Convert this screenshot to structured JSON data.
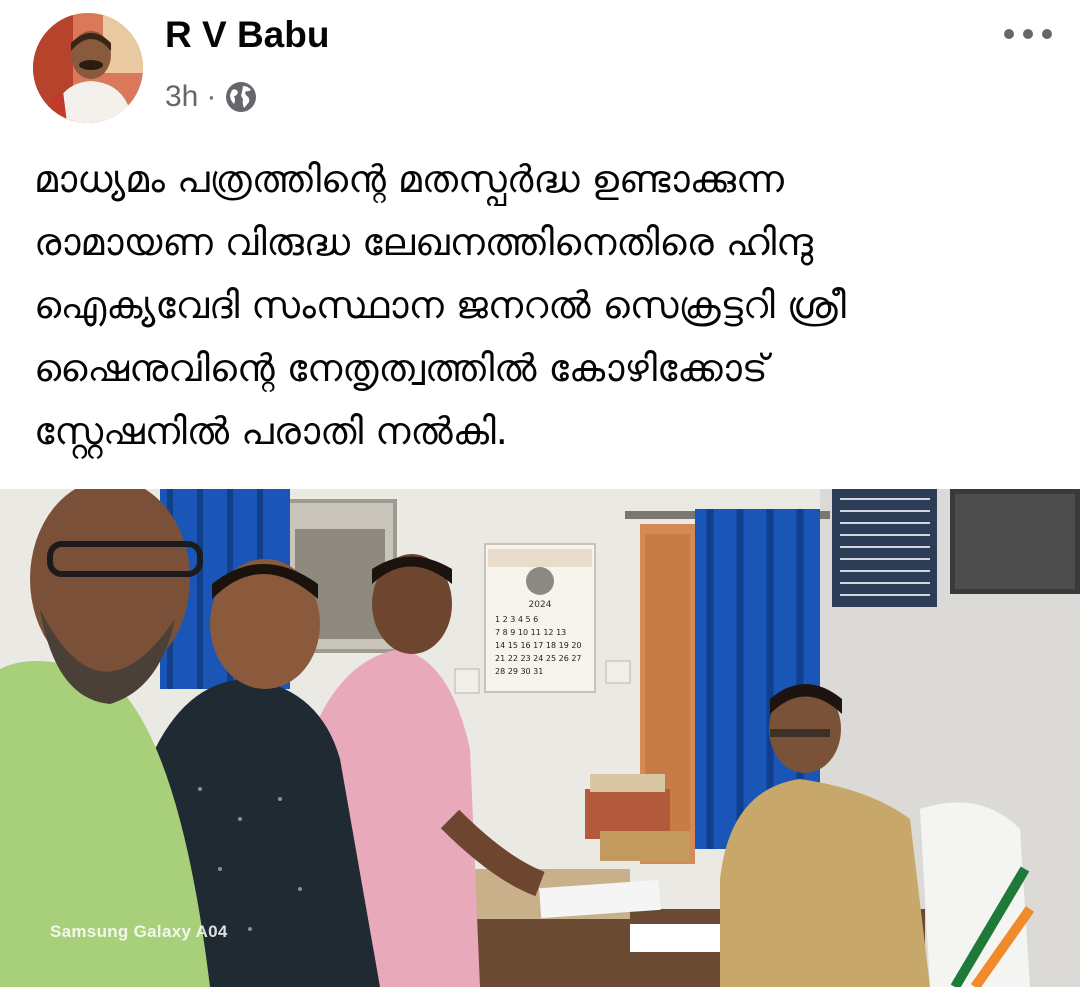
{
  "post": {
    "author": "R V Babu",
    "time": "3h",
    "separator": "·",
    "privacy_icon": "globe-icon",
    "menu_icon": "more-options-icon",
    "text_lines": [
      "മാധ്യമം പത്രത്തിന്റെ മതസ്പർദ്ധ ഉണ്ടാക്കുന്ന",
      "രാമായണ വിരുദ്ധ ലേഖനത്തിനെതിരെ ഹിന്ദു",
      "ഐക്യവേദി സംസ്ഥാന ജനറൽ സെക്രട്ടറി ശ്രീ",
      "ഷൈനുവിന്റെ നേതൃത്വത്തിൽ കോഴിക്കോട്",
      "സ്റ്റേഷനിൽ പരാതി നൽകി."
    ]
  },
  "photo": {
    "watermark": "Samsung Galaxy A04",
    "calendar_year": "2024",
    "calendar_days": [
      "1",
      "2",
      "3",
      "4",
      "5",
      "6",
      "7",
      "8",
      "9",
      "10",
      "11",
      "12",
      "13",
      "14",
      "15",
      "16",
      "17",
      "18",
      "19",
      "20",
      "21",
      "22",
      "23",
      "24",
      "25",
      "26",
      "27",
      "28",
      "29",
      "30",
      "31"
    ]
  },
  "colors": {
    "text": "#050505",
    "meta": "#65676b",
    "curtain_blue": "#1a56b8",
    "police_khaki": "#c8a86a",
    "shirt_green": "#a8cf7a",
    "shirt_pink": "#e8a9bb"
  }
}
